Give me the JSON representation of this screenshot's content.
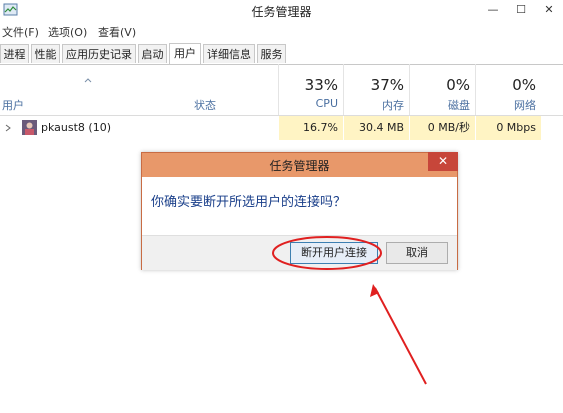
{
  "window": {
    "title": "任务管理器",
    "minimize_glyph": "—",
    "maximize_glyph": "☐",
    "close_glyph": "✕"
  },
  "menu": [
    "文件(F)",
    "选项(O)",
    "查看(V)"
  ],
  "tabs": [
    {
      "label": "进程",
      "active": false
    },
    {
      "label": "性能",
      "active": false
    },
    {
      "label": "应用历史记录",
      "active": false
    },
    {
      "label": "启动",
      "active": false
    },
    {
      "label": "用户",
      "active": true
    },
    {
      "label": "详细信息",
      "active": false
    },
    {
      "label": "服务",
      "active": false
    }
  ],
  "columns": {
    "user": "用户",
    "status": "状态",
    "cpu": {
      "percent": "33%",
      "name": "CPU"
    },
    "memory": {
      "percent": "37%",
      "name": "内存"
    },
    "disk": {
      "percent": "0%",
      "name": "磁盘"
    },
    "network": {
      "percent": "0%",
      "name": "网络"
    }
  },
  "rows": [
    {
      "user": "pkaust8 (10)",
      "status": "",
      "cpu": "16.7%",
      "memory": "30.4 MB",
      "disk": "0 MB/秒",
      "network": "0 Mbps"
    }
  ],
  "dialog": {
    "title": "任务管理器",
    "close_glyph": "✕",
    "question": "你确实要断开所选用户的连接吗？",
    "confirm_label": "断开用户连接",
    "cancel_label": "取消"
  },
  "colors": {
    "dialog_title_bg": "#e8986a",
    "close_button": "#c7463a",
    "annotation_red": "#e02020",
    "highlight_cells": "#fff4c4"
  }
}
